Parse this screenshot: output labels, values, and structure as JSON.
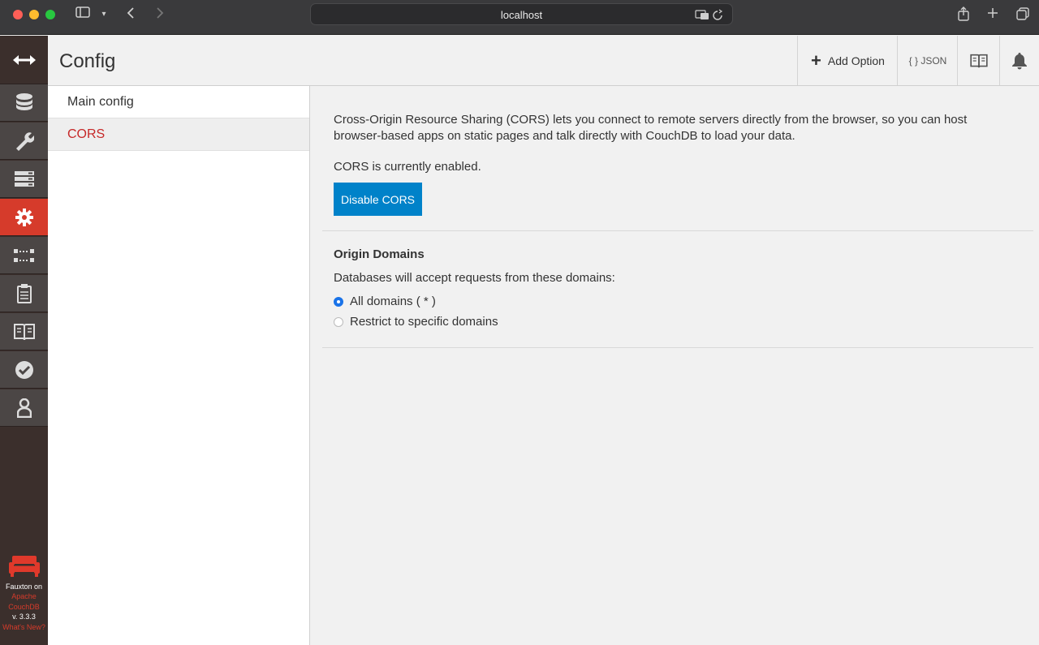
{
  "browser": {
    "url": "localhost"
  },
  "header": {
    "title": "Config",
    "add_option_label": "Add Option",
    "json_label": "{ } JSON"
  },
  "sidebar": {
    "items": [
      {
        "label": "Main config"
      },
      {
        "label": "CORS"
      }
    ]
  },
  "nav": {
    "icons": [
      "collapse-arrows-icon",
      "databases-icon",
      "setup-wrench-icon",
      "active-tasks-icon",
      "config-gear-icon",
      "replication-icon",
      "documentation-clipboard-icon",
      "docs-book-icon",
      "verify-check-icon",
      "user-icon"
    ],
    "footer": {
      "line1": "Fauxton on",
      "line2": "Apache",
      "line3": "CouchDB",
      "line4": "v. 3.3.3",
      "line5": "What's New?"
    }
  },
  "cors": {
    "description": "Cross-Origin Resource Sharing (CORS) lets you connect to remote servers directly from the browser, so you can host browser-based apps on static pages and talk directly with CouchDB to load your data.",
    "status": "CORS is currently enabled.",
    "disable_button": "Disable CORS",
    "origin_title": "Origin Domains",
    "origin_desc": "Databases will accept requests from these domains:",
    "options": [
      {
        "label": "All domains ( * )",
        "checked": true
      },
      {
        "label": "Restrict to specific domains",
        "checked": false
      }
    ]
  },
  "colors": {
    "nav_bg": "#3b2f2c",
    "active_red": "#d63b2b",
    "primary_blue": "#0082c9"
  }
}
